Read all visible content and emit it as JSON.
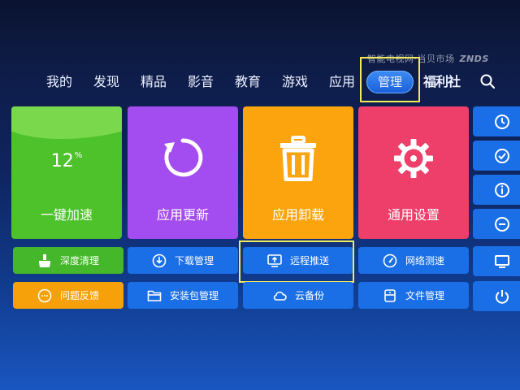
{
  "watermark": {
    "text": "智能电视网·当贝市场",
    "brand": "ZNDS"
  },
  "nav": {
    "items": [
      "我的",
      "发现",
      "精品",
      "影音",
      "教育",
      "游戏",
      "应用",
      "管理",
      "福利社"
    ],
    "active": "管理",
    "search_icon": "search-icon"
  },
  "tiles": {
    "speedup": {
      "percent": "12",
      "percent_unit": "%",
      "label": "一键加速"
    },
    "update": {
      "label": "应用更新",
      "icon": "refresh-icon"
    },
    "uninstall": {
      "label": "应用卸载",
      "icon": "trash-icon"
    },
    "settings": {
      "label": "通用设置",
      "icon": "gear-icon"
    }
  },
  "buttons": {
    "deep_clean": {
      "label": "深度清理",
      "icon": "broom-icon"
    },
    "download_mgr": {
      "label": "下载管理",
      "icon": "download-icon"
    },
    "remote_push": {
      "label": "远程推送",
      "icon": "screen-upload-icon"
    },
    "net_speed": {
      "label": "网络测速",
      "icon": "speedometer-icon"
    },
    "feedback": {
      "label": "问题反馈",
      "icon": "chat-icon"
    },
    "pkg_mgr": {
      "label": "安装包管理",
      "icon": "folder-icon"
    },
    "cloud_backup": {
      "label": "云备份",
      "icon": "cloud-icon"
    },
    "file_mgr": {
      "label": "文件管理",
      "icon": "file-icon"
    }
  },
  "colors": {
    "accent_blue": "#1a6fe6",
    "green": "#4dc22a",
    "purple": "#a34cf0",
    "orange": "#fba40d",
    "red": "#ee3f6a",
    "focus": "#f2ec5a"
  }
}
